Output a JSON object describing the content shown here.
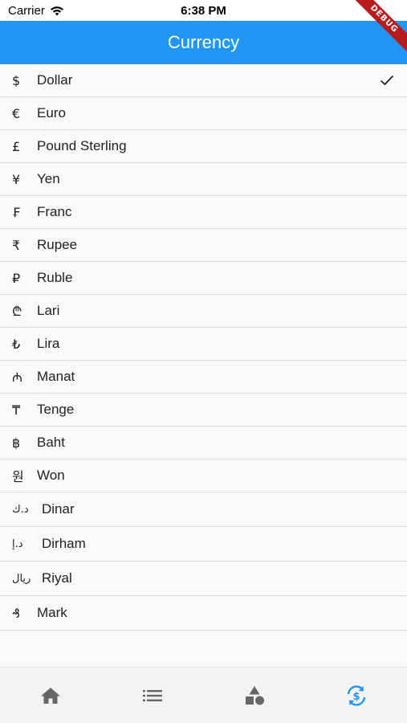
{
  "status_bar": {
    "carrier": "Carrier",
    "time": "6:38 PM",
    "wifi_icon": "wifi-icon"
  },
  "app_bar": {
    "title": "Currency",
    "color": "#2196f3"
  },
  "debug_banner": {
    "label": "DEBUG"
  },
  "currencies": [
    {
      "symbol": "$",
      "label": "Dollar",
      "selected": true
    },
    {
      "symbol": "€",
      "label": "Euro",
      "selected": false
    },
    {
      "symbol": "£",
      "label": "Pound Sterling",
      "selected": false
    },
    {
      "symbol": "¥",
      "label": "Yen",
      "selected": false
    },
    {
      "symbol": "₣",
      "label": "Franc",
      "selected": false
    },
    {
      "symbol": "₹",
      "label": "Rupee",
      "selected": false
    },
    {
      "symbol": "₽",
      "label": "Ruble",
      "selected": false
    },
    {
      "symbol": "₾",
      "label": "Lari",
      "selected": false
    },
    {
      "symbol": "₺",
      "label": "Lira",
      "selected": false
    },
    {
      "symbol": "₼",
      "label": "Manat",
      "selected": false
    },
    {
      "symbol": "₸",
      "label": "Tenge",
      "selected": false
    },
    {
      "symbol": "฿",
      "label": "Baht",
      "selected": false
    },
    {
      "symbol": "원",
      "label": "Won",
      "selected": false
    },
    {
      "symbol": "د.ك",
      "label": "Dinar",
      "selected": false
    },
    {
      "symbol": "د.إ",
      "label": "Dirham",
      "selected": false
    },
    {
      "symbol": "ريال",
      "label": "Riyal",
      "selected": false
    },
    {
      "symbol": "₰",
      "label": "Mark",
      "selected": false
    }
  ],
  "bottom_nav": {
    "items": [
      {
        "icon": "home-icon",
        "active": false
      },
      {
        "icon": "list-icon",
        "active": false
      },
      {
        "icon": "shapes-icon",
        "active": false
      },
      {
        "icon": "currency-exchange-icon",
        "active": true
      }
    ],
    "active_color": "#2196f3",
    "inactive_color": "#666666"
  }
}
